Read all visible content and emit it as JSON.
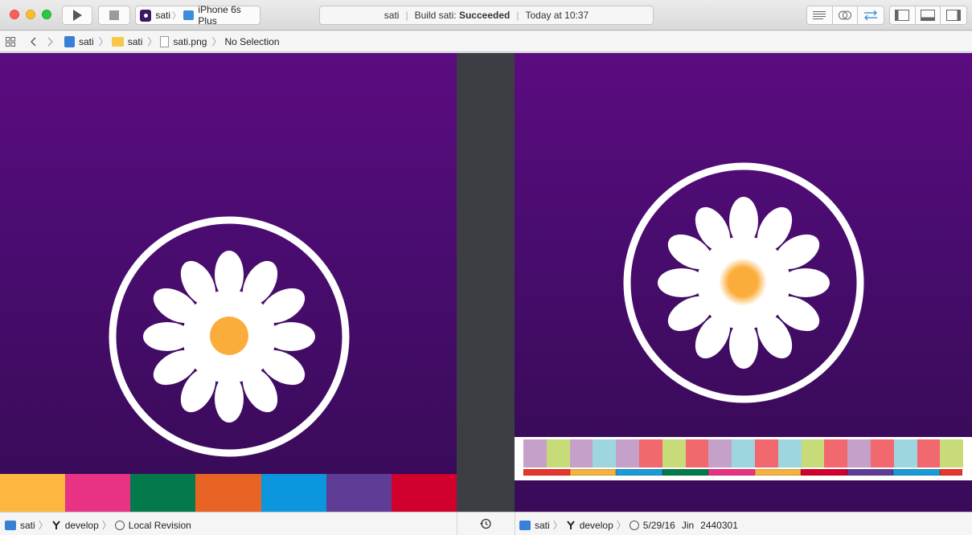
{
  "toolbar": {
    "scheme_name": "sati",
    "device_name": "iPhone 6s Plus",
    "activity_project": "sati",
    "activity_build_prefix": "Build sati:",
    "activity_build_status": "Succeeded",
    "activity_time": "Today at 10:37"
  },
  "jumpbar": {
    "crumbs": [
      "sati",
      "sati",
      "sati.png",
      "No Selection"
    ]
  },
  "left_status": {
    "project": "sati",
    "branch": "develop",
    "revision": "Local Revision"
  },
  "right_status": {
    "project": "sati",
    "branch": "develop",
    "date": "5/29/16",
    "author": "Jin",
    "commit": "2440301"
  },
  "left_artwork": {
    "stripe_colors": [
      "#fdb73e",
      "#e83283",
      "#047a4c",
      "#e86424",
      "#0b96dd",
      "#5f3d96",
      "#d2002d"
    ]
  },
  "right_artwork": {
    "swatch_colors": [
      "#c5a0c8",
      "#c7dc78",
      "#c5a0c8",
      "#9dd6df",
      "#c5a0c8",
      "#f2686f",
      "#c7dc78",
      "#f2686f",
      "#c5a0c8",
      "#9dd6df",
      "#f2686f",
      "#9dd6df",
      "#c7dc78",
      "#f2686f",
      "#c5a0c8",
      "#f2686f",
      "#9dd6df",
      "#f2686f",
      "#c7dc78"
    ],
    "bar_colors": [
      "#e7362c",
      "#f6b23f",
      "#1a9ad7",
      "#047a4c",
      "#e83283",
      "#f6b23f",
      "#d2002d",
      "#5f3d96",
      "#1a9ad7",
      "#e7362c"
    ]
  },
  "colors": {
    "artwork_purple_top": "#5c0c80",
    "artwork_purple_bottom": "#3a0b5a",
    "divider": "#3c3e44",
    "flower_center": "#fbad3c",
    "accent_blue": "#2d7fdc"
  }
}
